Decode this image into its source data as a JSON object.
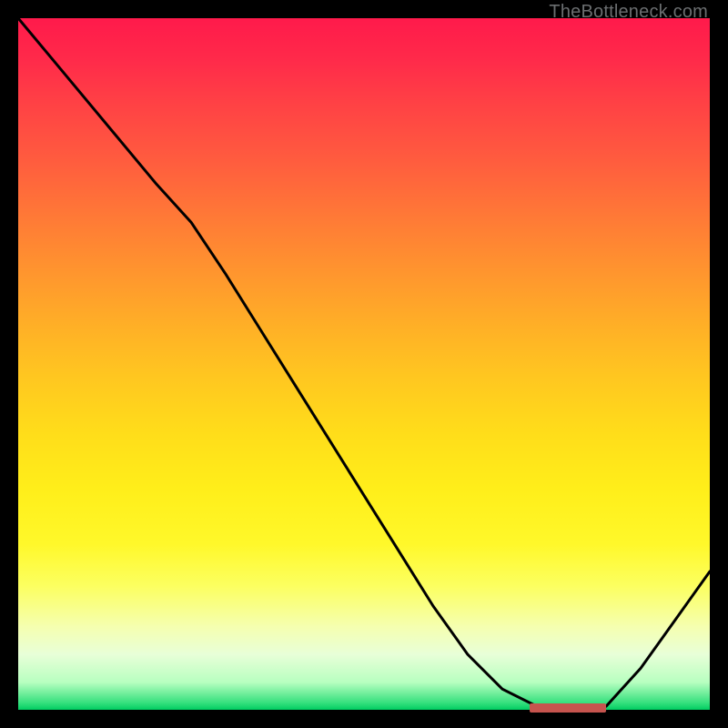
{
  "watermark": "TheBottleneck.com",
  "colors": {
    "gradient_top": "#ff1a4b",
    "gradient_mid": "#ffee1a",
    "gradient_bottom": "#00cc61",
    "curve": "#000000",
    "marker": "#c6544e",
    "frame": "#000000"
  },
  "chart_data": {
    "type": "line",
    "title": "",
    "xlabel": "",
    "ylabel": "",
    "xlim": [
      0,
      100
    ],
    "ylim": [
      0,
      100
    ],
    "x": [
      0,
      5,
      10,
      15,
      20,
      25,
      30,
      35,
      40,
      45,
      50,
      55,
      60,
      65,
      70,
      75,
      80,
      83,
      85,
      90,
      95,
      100
    ],
    "values": [
      100,
      94,
      88,
      82,
      76,
      70.5,
      63,
      55,
      47,
      39,
      31,
      23,
      15,
      8,
      3,
      0.5,
      0,
      0,
      0.5,
      6,
      13,
      20
    ],
    "series": [
      {
        "name": "curve",
        "values": [
          100,
          94,
          88,
          82,
          76,
          70.5,
          63,
          55,
          47,
          39,
          31,
          23,
          15,
          8,
          3,
          0.5,
          0,
          0,
          0.5,
          6,
          13,
          20
        ]
      }
    ],
    "marker": {
      "x_start": 74,
      "x_end": 85,
      "y": 0
    },
    "grid": false,
    "legend": false
  }
}
